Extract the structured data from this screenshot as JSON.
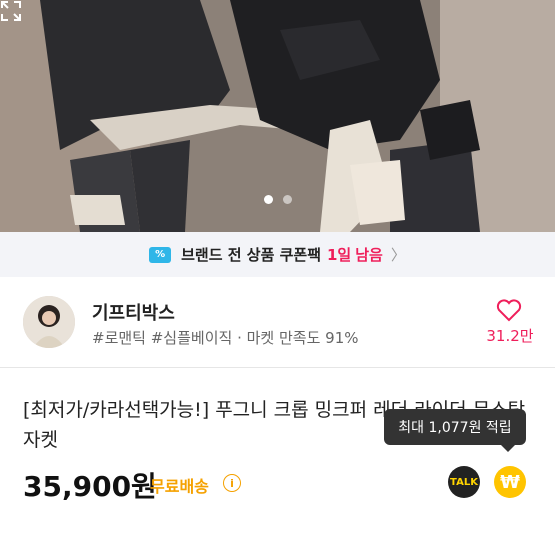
{
  "gallery": {
    "current_slide": 1,
    "total_slides": 2
  },
  "coupon": {
    "icon": "coupon-icon",
    "text": "브랜드 전 상품 쿠폰팩",
    "highlight": "1일",
    "rest": "남음",
    "chevron": "〉"
  },
  "seller": {
    "name": "기프티박스",
    "tags": "#로맨틱 #심플베이직 · 마켓 만족도 91%",
    "likes": "31.2만"
  },
  "product": {
    "title": "[최저가/카라선택가능!] 푸그니 크롭 밍크퍼 레더 라이더 무스탕 자켓",
    "price": "35,900원",
    "shipping": "무료배송",
    "info_symbol": "i",
    "reward_tooltip": "최대 1,077원 적립",
    "talk_label": "TALK",
    "reward_symbol": "₩"
  },
  "colors": {
    "accent": "#ef1f5b",
    "shipping": "#f5a100",
    "coupon_icon": "#2fb6e8",
    "reward": "#ffc400"
  }
}
